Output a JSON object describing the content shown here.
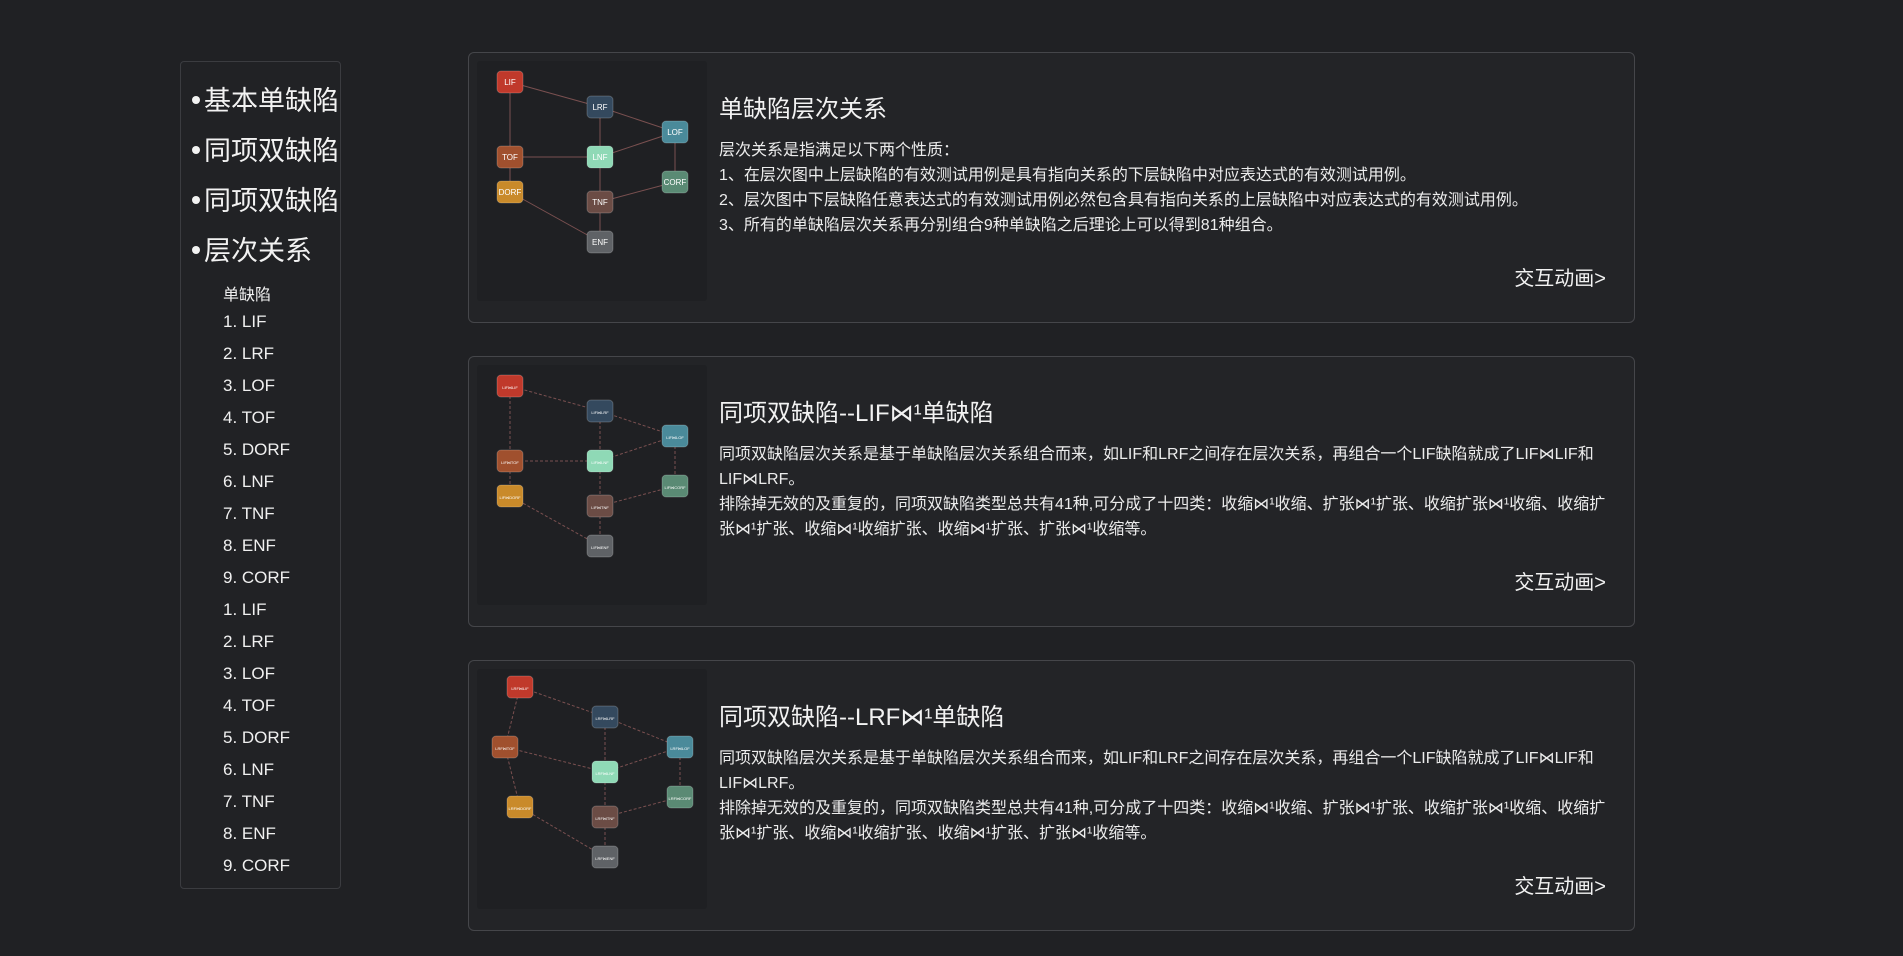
{
  "sidebar": {
    "sections": [
      "基本单缺陷",
      "同项双缺陷",
      "同项双缺陷",
      "层次关系"
    ],
    "sub_header": "单缺陷",
    "items": [
      "1. LIF",
      "2. LRF",
      "3. LOF",
      "4. TOF",
      "5. DORF",
      "6. LNF",
      "7. TNF",
      "8. ENF",
      "9. CORF",
      "1. LIF",
      "2. LRF",
      "3. LOF",
      "4. TOF",
      "5. DORF",
      "6. LNF",
      "7. TNF",
      "8. ENF",
      "9. CORF"
    ]
  },
  "cards": [
    {
      "title": "单缺陷层次关系",
      "paragraphs": [
        "层次关系是指满足以下两个性质：",
        "1、在层次图中上层缺陷的有效测试用例是具有指向关系的下层缺陷中对应表达式的有效测试用例。",
        "2、层次图中下层缺陷任意表达式的有效测试用例必然包含具有指向关系的上层缺陷中对应表达式的有效测试用例。",
        "3、所有的单缺陷层次关系再分别组合9种单缺陷之后理论上可以得到81种组合。"
      ],
      "link": "交互动画>",
      "diagram_nodes": [
        "LIF",
        "LRF",
        "LOF",
        "TOF",
        "LNF",
        "CORF",
        "DORF",
        "TNF",
        "ENF"
      ]
    },
    {
      "title": "同项双缺陷--LIF⋈¹单缺陷",
      "paragraphs": [
        "同项双缺陷层次关系是基于单缺陷层次关系组合而来，如LIF和LRF之间存在层次关系，再组合一个LIF缺陷就成了LIF⋈LIF和LIF⋈LRF。",
        "排除掉无效的及重复的，同项双缺陷类型总共有41种,可分成了十四类：收缩⋈¹收缩、扩张⋈¹扩张、收缩扩张⋈¹收缩、收缩扩张⋈¹扩张、收缩⋈¹收缩扩张、收缩⋈¹扩张、扩张⋈¹收缩等。"
      ],
      "link": "交互动画>",
      "diagram_nodes": [
        "LIF⋈LIF",
        "LIF⋈LRF",
        "LIF⋈LOF",
        "LIF⋈TOF",
        "LIF⋈LNF",
        "LIF⋈CORF",
        "LIF⋈DORF",
        "LIF⋈TNF",
        "LIF⋈ENF"
      ]
    },
    {
      "title": "同项双缺陷--LRF⋈¹单缺陷",
      "paragraphs": [
        "同项双缺陷层次关系是基于单缺陷层次关系组合而来，如LIF和LRF之间存在层次关系，再组合一个LIF缺陷就成了LIF⋈LIF和LIF⋈LRF。",
        "排除掉无效的及重复的，同项双缺陷类型总共有41种,可分成了十四类：收缩⋈¹收缩、扩张⋈¹扩张、收缩扩张⋈¹收缩、收缩扩张⋈¹扩张、收缩⋈¹收缩扩张、收缩⋈¹扩张、扩张⋈¹收缩等。"
      ],
      "link": "交互动画>",
      "diagram_nodes": [
        "LRF⋈LIF",
        "LRF⋈LRF",
        "LRF⋈LOF",
        "LRF⋈TOF",
        "LRF⋈LNF",
        "LRF⋈CORF",
        "LRF⋈DORF",
        "LRF⋈TNF",
        "LRF⋈ENF"
      ]
    }
  ],
  "colors": {
    "LIF": "#c0392b",
    "LRF": "#34495e",
    "LOF": "#4a8a9a",
    "TOF": "#a0502e",
    "LNF": "#8fd9b6",
    "CORF": "#5a8a74",
    "DORF": "#c98a2a",
    "TNF": "#6b4c45",
    "ENF": "#5f6266"
  }
}
